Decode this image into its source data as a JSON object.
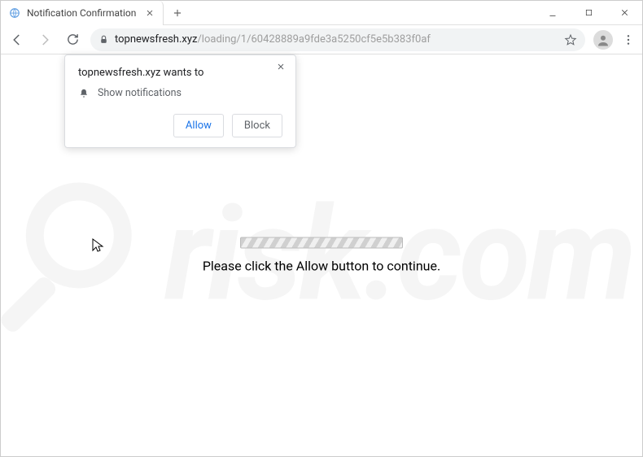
{
  "tab": {
    "title": "Notification Confirmation"
  },
  "url": {
    "host": "topnewsfresh.xyz",
    "path": "/loading/1/60428889a9fde3a5250cf5e5b383f0af"
  },
  "permission": {
    "origin": "topnewsfresh.xyz wants to",
    "capability": "Show notifications",
    "allow": "Allow",
    "block": "Block"
  },
  "page": {
    "instruction": "Please click the Allow button to continue."
  },
  "watermark": "risk.com"
}
